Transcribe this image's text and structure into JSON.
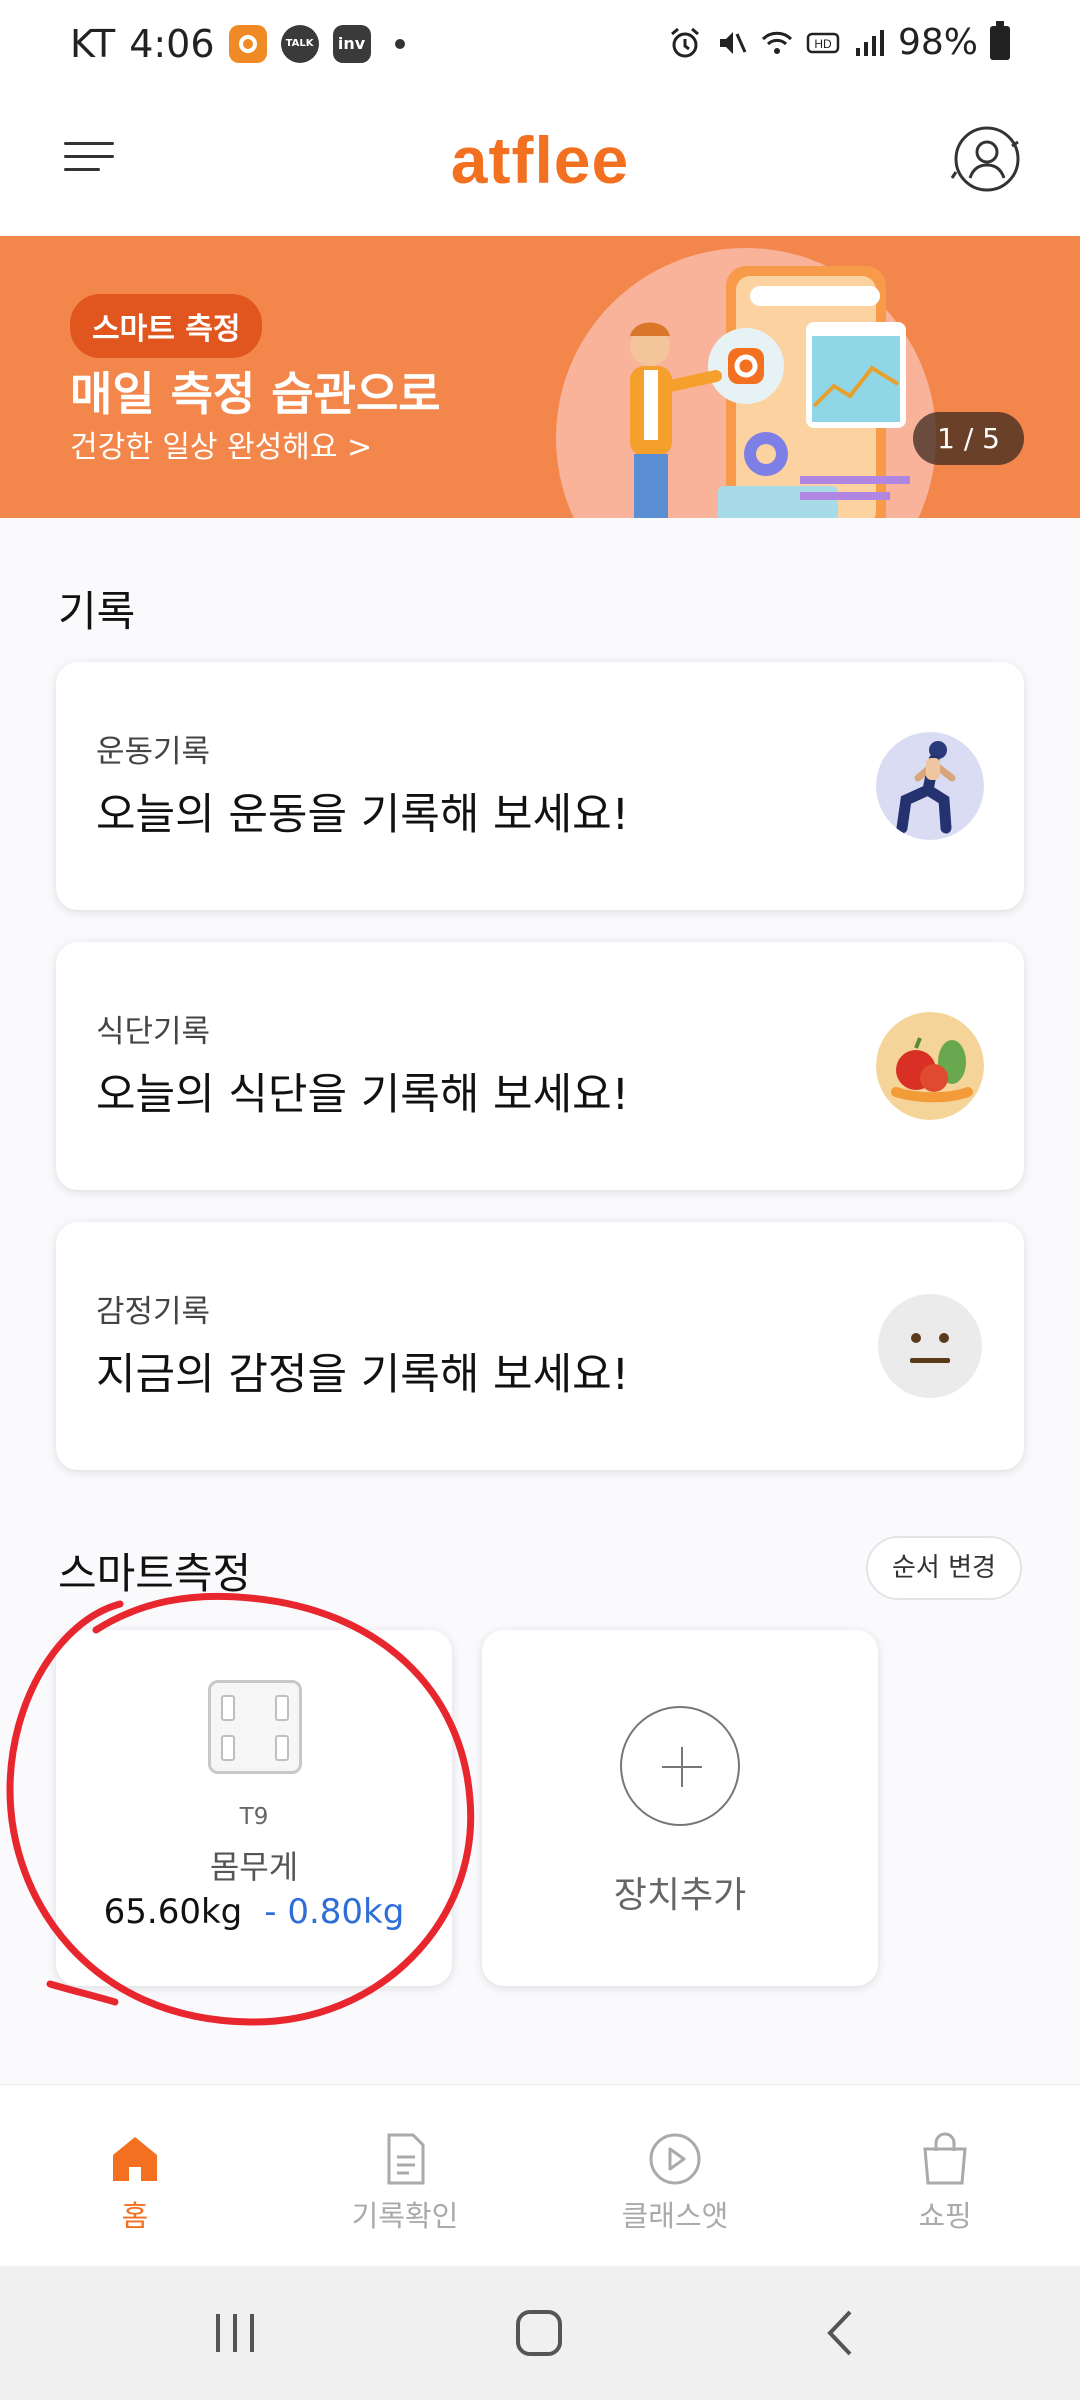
{
  "status_bar": {
    "carrier": "KT",
    "time": "4:06",
    "app_icons": [
      "atflee-icon",
      "talk-icon",
      "inv-icon"
    ],
    "battery": "98%"
  },
  "header": {
    "logo": "atflee"
  },
  "banner": {
    "tag": "스마트 측정",
    "title": "매일 측정 습관으로",
    "subtitle": "건강한 일상 완성해요 >",
    "counter": "1 / 5"
  },
  "records": {
    "title": "기록",
    "cards": [
      {
        "label": "운동기록",
        "text": "오늘의 운동을 기록해 보세요!",
        "icon": "runner-icon"
      },
      {
        "label": "식단기록",
        "text": "오늘의 식단을 기록해 보세요!",
        "icon": "food-icon"
      },
      {
        "label": "감정기록",
        "text": "지금의 감정을 기록해 보세요!",
        "icon": "neutral-face-icon"
      }
    ]
  },
  "smart": {
    "title": "스마트측정",
    "order_button": "순서 변경",
    "device": {
      "model": "T9",
      "name": "몸무게",
      "weight": "65.60kg",
      "delta": "- 0.80kg"
    },
    "add_label": "장치추가"
  },
  "nav": {
    "items": [
      {
        "label": "홈",
        "icon": "home-icon"
      },
      {
        "label": "기록확인",
        "icon": "document-icon"
      },
      {
        "label": "클래스앳",
        "icon": "play-icon"
      },
      {
        "label": "쇼핑",
        "icon": "shopping-bag-icon"
      }
    ]
  },
  "colors": {
    "brand": "#f37021",
    "banner_bg": "#f3864a",
    "delta_blue": "#2e6ed6",
    "annotation_red": "#e8262d"
  }
}
